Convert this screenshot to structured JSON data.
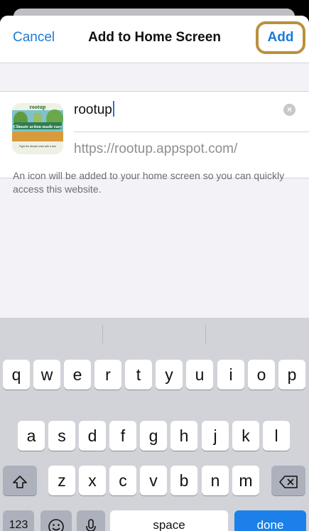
{
  "nav": {
    "cancel_label": "Cancel",
    "title": "Add to Home Screen",
    "add_label": "Add"
  },
  "app_icon": {
    "label_top": "rootup",
    "label_mid": "Climate action made easy",
    "label_bottom": "Fight the climate crisis with a tree"
  },
  "form": {
    "name_value": "rootup",
    "url": "https://rootup.appspot.com/"
  },
  "hint_text": "An icon will be added to your home screen so you can quickly access this website.",
  "keyboard": {
    "row1": [
      "q",
      "w",
      "e",
      "r",
      "t",
      "y",
      "u",
      "i",
      "o",
      "p"
    ],
    "row2": [
      "a",
      "s",
      "d",
      "f",
      "g",
      "h",
      "j",
      "k",
      "l"
    ],
    "row3": [
      "z",
      "x",
      "c",
      "v",
      "b",
      "n",
      "m"
    ],
    "numbers_label": "123",
    "space_label": "space",
    "done_label": "done"
  },
  "colors": {
    "accent": "#1a7bd6",
    "highlight_border": "#b9913c",
    "done_key": "#1b80e9"
  }
}
